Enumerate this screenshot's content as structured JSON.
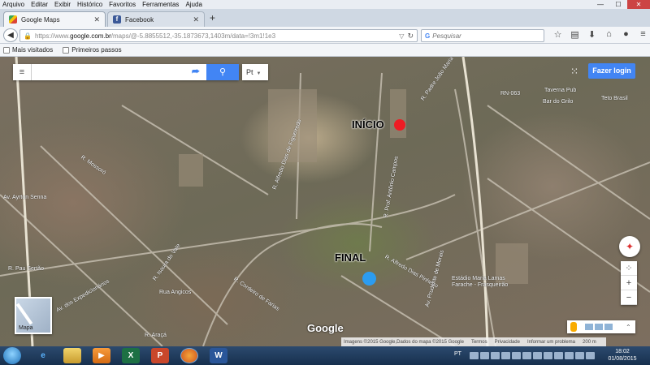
{
  "menubar": {
    "items": [
      "Arquivo",
      "Editar",
      "Exibir",
      "Histórico",
      "Favoritos",
      "Ferramentas",
      "Ajuda"
    ]
  },
  "window_controls": {
    "minimize": "—",
    "maximize": "☐",
    "close": "✕"
  },
  "tabs": [
    {
      "title": "Google Maps",
      "close": "✕",
      "active": true
    },
    {
      "title": "Facebook",
      "close": "✕",
      "active": false
    }
  ],
  "new_tab": "+",
  "navbar": {
    "url_prefix": "https://www.",
    "url_domain": "google.com.br",
    "url_path": "/maps/@-5.8855512,-35.1873673,1403m/data=!3m1!1e3",
    "search_placeholder": "Pesquisar"
  },
  "bookmarks": [
    "Mais visitados",
    "Primeiros passos"
  ],
  "map": {
    "search_value": "",
    "language": "Pt",
    "login_label": "Fazer login",
    "inicio_label": "INÍCIO",
    "final_label": "FINAL",
    "marker_colors": {
      "inicio": "#ee1c24",
      "final": "#2b9cf0"
    },
    "accent_color": "#4285f4",
    "streets": {
      "s1": "R. Alfredo Dias de Figueiredo",
      "s2": "R. Prof. Antônio Campos",
      "s3": "Av. Ayrton Senna",
      "s4": "R. Pau Sertão",
      "s5": "Av. dos Expedicionários",
      "s6": "R. Isaura do Vale",
      "s7": "Rua Angicos",
      "s8": "R. Araçá",
      "s9": "R. Mossoró",
      "s10": "R. Cordeiro de Farias",
      "s11": "R. Alfredo Dias Pinheiro",
      "s12": "RN-063",
      "s13": "Av. Prudente de Morais",
      "s14": "R. Padre João Maria"
    },
    "places": {
      "p1": "Taverna Pub",
      "p2": "Bar do Grilo",
      "p3": "Teto Brasil",
      "p4": "Estádio Maria Lamas Farache - Frasqueirão"
    },
    "satellite_label": "Mapa",
    "google_logo": "Google",
    "footer": [
      "Imagens ©2015 Google,Dados do mapa ©2015 Google",
      "Termos",
      "Privacidade",
      "Informar um problema",
      "200 m"
    ]
  },
  "taskbar": {
    "lang": "PT",
    "time": "18:02",
    "date": "01/08/2015"
  }
}
